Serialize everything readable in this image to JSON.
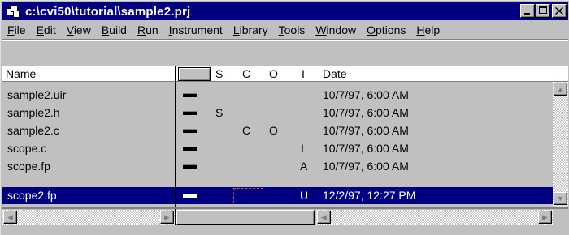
{
  "window": {
    "title": "c:\\cvi50\\tutorial\\sample2.prj",
    "buttons": {
      "minimize": "_",
      "maximize": "□",
      "close": "×"
    }
  },
  "menu": [
    {
      "label": "File",
      "underline": "F",
      "rest": "ile"
    },
    {
      "label": "Edit",
      "underline": "E",
      "rest": "dit"
    },
    {
      "label": "View",
      "underline": "V",
      "rest": "iew"
    },
    {
      "label": "Build",
      "underline": "B",
      "rest": "uild"
    },
    {
      "label": "Run",
      "underline": "R",
      "rest": "un"
    },
    {
      "label": "Instrument",
      "underline": "I",
      "rest": "nstrument"
    },
    {
      "label": "Library",
      "underline": "L",
      "rest": "ibrary"
    },
    {
      "label": "Tools",
      "underline": "T",
      "rest": "ools"
    },
    {
      "label": "Window",
      "underline": "W",
      "rest": "indow"
    },
    {
      "label": "Options",
      "underline": "O",
      "rest": "ptions"
    },
    {
      "label": "Help",
      "underline": "H",
      "rest": "elp"
    }
  ],
  "columns": {
    "name": "Name",
    "s": "S",
    "c": "C",
    "o": "O",
    "i": "I",
    "date": "Date"
  },
  "files": [
    {
      "name": "sample2.uir",
      "s": "",
      "c": "",
      "o": "",
      "i": "",
      "date": "10/7/97,  6:00 AM",
      "selected": false
    },
    {
      "name": "sample2.h",
      "s": "S",
      "c": "",
      "o": "",
      "i": "",
      "date": "10/7/97,  6:00 AM",
      "selected": false
    },
    {
      "name": "sample2.c",
      "s": "",
      "c": "C",
      "o": "O",
      "i": "",
      "date": "10/7/97,  6:00 AM",
      "selected": false
    },
    {
      "name": "scope.c",
      "s": "",
      "c": "",
      "o": "",
      "i": "I",
      "date": "10/7/97,  6:00 AM",
      "selected": false
    },
    {
      "name": "scope.fp",
      "s": "",
      "c": "",
      "o": "",
      "i": "A",
      "date": "10/7/97,  6:00 AM",
      "selected": false
    },
    {
      "name": "scope2.fp",
      "s": "",
      "c": "",
      "o": "",
      "i": "U",
      "date": "12/2/97, 12:27 PM",
      "selected": true
    }
  ],
  "scrollbar": {
    "up": "▲",
    "down": "▼",
    "left": "◀",
    "right": "▶"
  },
  "colors": {
    "title_bg": "#000080",
    "selection_bg": "#000080",
    "face": "#c0c0c0"
  }
}
